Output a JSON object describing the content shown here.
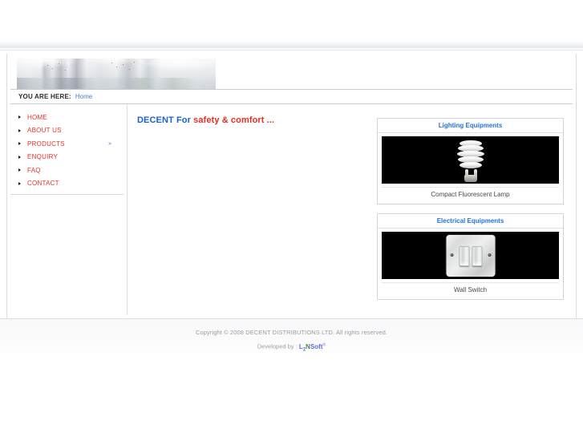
{
  "site": {
    "name": "DECENT DISTRIBUTIONS LTD."
  },
  "header": {
    "banner_alt": "office-corridor-banner"
  },
  "breadcrumb": {
    "label": "YOU ARE HERE:",
    "current": "Home"
  },
  "sidebar": {
    "items": [
      {
        "label": "HOME",
        "more": ""
      },
      {
        "label": "ABOUT US",
        "more": ""
      },
      {
        "label": "PRODUCTS",
        "more": "»"
      },
      {
        "label": "ENQUIRY",
        "more": ""
      },
      {
        "label": "FAQ",
        "more": ""
      },
      {
        "label": "CONTACT",
        "more": ""
      }
    ]
  },
  "main": {
    "title_primary": "DECENT For ",
    "title_accent": "safety & comfort ..."
  },
  "products": {
    "cards": [
      {
        "title": "Lighting Equipments",
        "caption": "Compact Fluorescent Lamp",
        "image_name": "compact-fluorescent-lamp-image"
      },
      {
        "title": "Electrical Equipments",
        "caption": "Wall Switch",
        "image_name": "wall-switch-image"
      }
    ]
  },
  "footer": {
    "copyright": "Copyright © 2008 DECENT DISTRIBUTIONS LTD. All rights reserved.",
    "developed_by_label": "Developed by : ",
    "brand": {
      "l": "L",
      "sub": "2",
      "n": "N",
      "soft": "Soft",
      "reg": "®"
    }
  },
  "colors": {
    "nav_red": "#ee3124",
    "link_blue": "#3f7fd0",
    "title_blue": "#1b5fd0",
    "title_red": "#ee2b20",
    "card_title_blue": "#2272de",
    "footer_grey": "#9a9da2"
  }
}
